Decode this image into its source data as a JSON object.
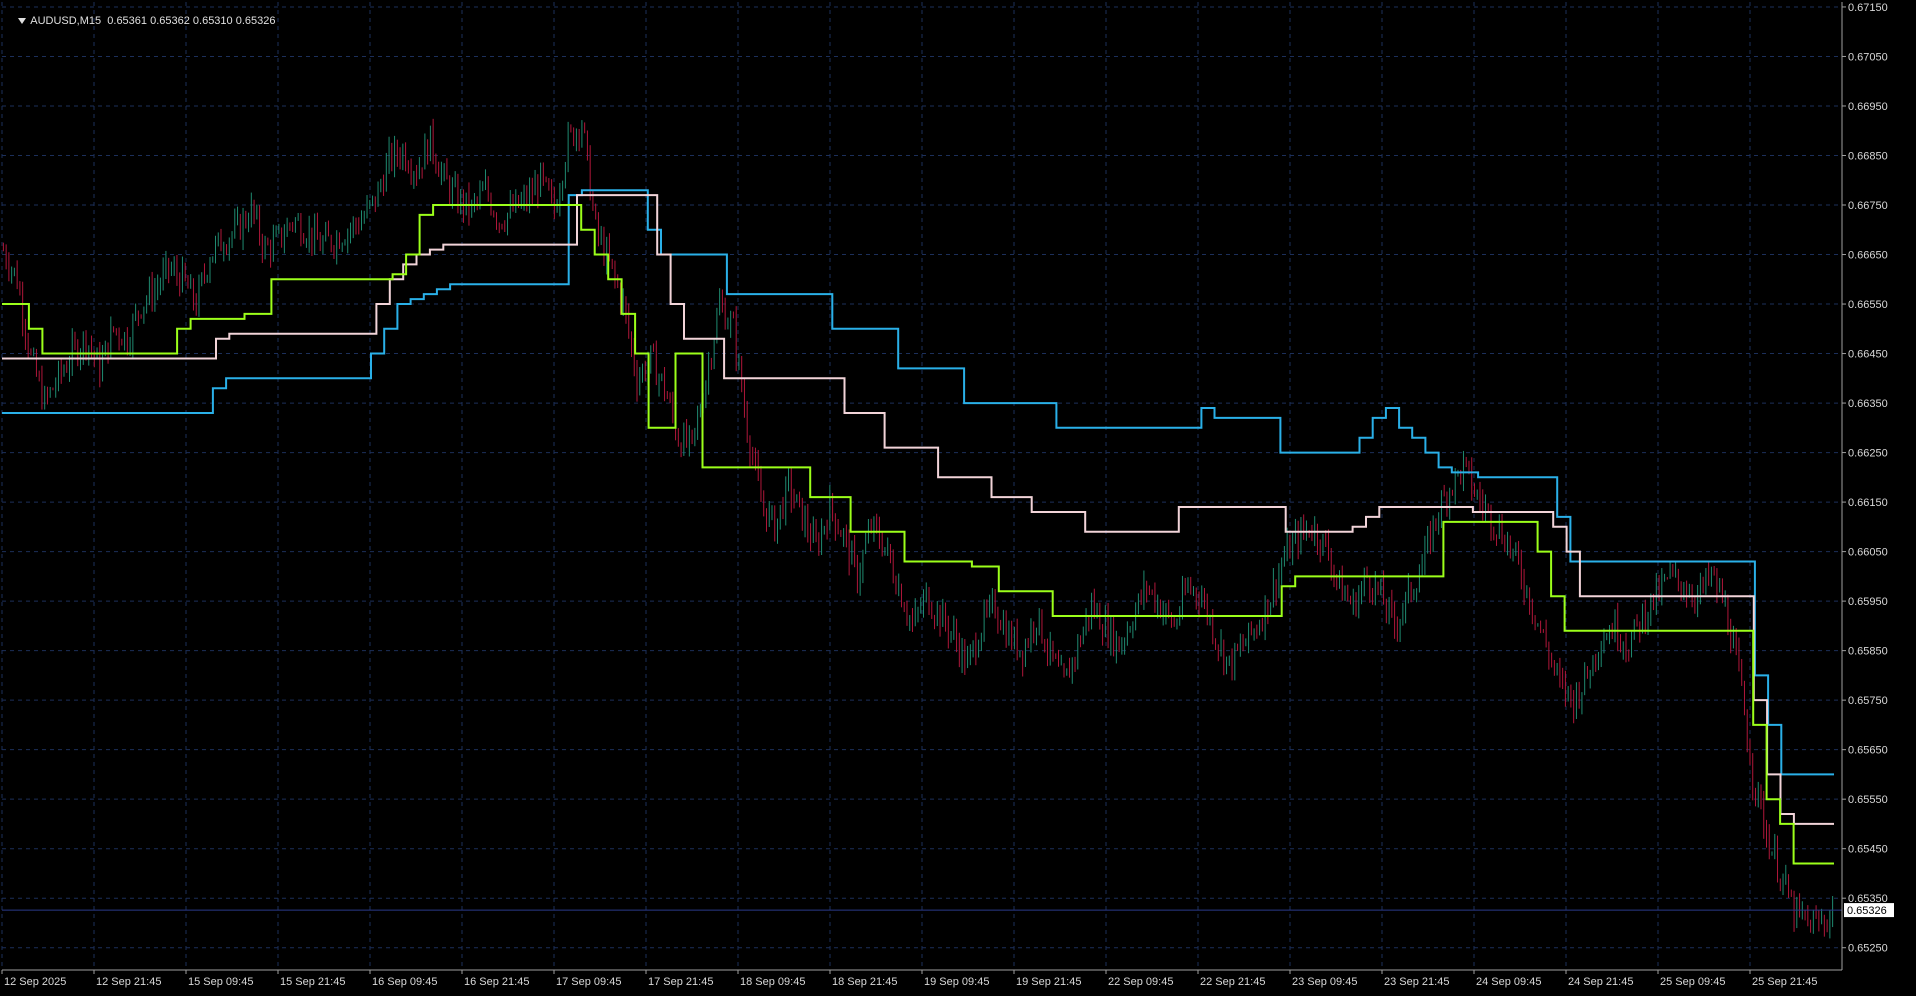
{
  "header": {
    "symbol": "AUDUSD,M15",
    "ohlc": "0.65361 0.65362 0.65310 0.65326"
  },
  "colors": {
    "background": "#000000",
    "grid": "#1c2f5a",
    "axis": "#a0a0a0",
    "candle_up": "#1f8a70",
    "candle_down": "#b0173a",
    "upper_band": "#2ab0e8",
    "middle_band": "#f2d4d9",
    "lower_band": "#9cff1a",
    "current_price_line": "#2a3a8a"
  },
  "chart_data": {
    "type": "line",
    "title": "",
    "symbol": "AUDUSD",
    "timeframe": "M15",
    "current_price": 0.65326,
    "current_price_label": "0.65326",
    "ylim": [
      0.65205,
      0.6716
    ],
    "grid": true,
    "y_ticks": [
      "0.67150",
      "0.67050",
      "0.66950",
      "0.66850",
      "0.66750",
      "0.66650",
      "0.66550",
      "0.66450",
      "0.66350",
      "0.66250",
      "0.66150",
      "0.66050",
      "0.65950",
      "0.65850",
      "0.65750",
      "0.65650",
      "0.65550",
      "0.65450",
      "0.65350",
      "0.65250"
    ],
    "x_ticks": [
      "12 Sep 2025",
      "12 Sep 21:45",
      "15 Sep 09:45",
      "15 Sep 21:45",
      "16 Sep 09:45",
      "16 Sep 21:45",
      "17 Sep 09:45",
      "17 Sep 21:45",
      "18 Sep 09:45",
      "18 Sep 21:45",
      "19 Sep 09:45",
      "19 Sep 21:45",
      "22 Sep 09:45",
      "22 Sep 21:45",
      "23 Sep 09:45",
      "23 Sep 21:45",
      "24 Sep 09:45",
      "24 Sep 21:45",
      "25 Sep 09:45",
      "25 Sep 21:45"
    ],
    "price_path": [
      0.6666,
      0.666,
      0.6644,
      0.6635,
      0.664,
      0.6645,
      0.6648,
      0.6642,
      0.665,
      0.6648,
      0.6655,
      0.6658,
      0.6662,
      0.666,
      0.6655,
      0.6665,
      0.6668,
      0.667,
      0.6674,
      0.6666,
      0.6668,
      0.6672,
      0.667,
      0.6667,
      0.6668,
      0.667,
      0.6672,
      0.6676,
      0.6684,
      0.6686,
      0.6682,
      0.6688,
      0.668,
      0.6676,
      0.6674,
      0.6678,
      0.6672,
      0.6674,
      0.6676,
      0.668,
      0.6674,
      0.6688,
      0.6692,
      0.667,
      0.6663,
      0.6655,
      0.664,
      0.6644,
      0.6638,
      0.6628,
      0.6626,
      0.664,
      0.6655,
      0.665,
      0.663,
      0.6615,
      0.661,
      0.6618,
      0.6612,
      0.6606,
      0.6614,
      0.6608,
      0.66,
      0.661,
      0.6606,
      0.6598,
      0.659,
      0.6596,
      0.6592,
      0.6588,
      0.6582,
      0.659,
      0.6594,
      0.6588,
      0.6585,
      0.6592,
      0.6584,
      0.6578,
      0.6586,
      0.6594,
      0.659,
      0.6586,
      0.6592,
      0.6598,
      0.6594,
      0.659,
      0.6598,
      0.6596,
      0.6588,
      0.6582,
      0.6586,
      0.659,
      0.6596,
      0.6604,
      0.6608,
      0.661,
      0.6606,
      0.6598,
      0.6594,
      0.66,
      0.6596,
      0.659,
      0.6596,
      0.6602,
      0.6612,
      0.6618,
      0.6622,
      0.6616,
      0.6612,
      0.6608,
      0.6602,
      0.6594,
      0.6586,
      0.6578,
      0.6575,
      0.658,
      0.6588,
      0.659,
      0.6586,
      0.6592,
      0.6596,
      0.66,
      0.6598,
      0.6596,
      0.66,
      0.6594,
      0.658,
      0.656,
      0.6548,
      0.654,
      0.6532,
      0.653,
      0.653,
      0.65326
    ],
    "series": [
      {
        "color": "#2ab0e8",
        "values": [
          0.6633,
          0.6633,
          0.6633,
          0.6633,
          0.6633,
          0.6633,
          0.6633,
          0.6633,
          0.6633,
          0.6633,
          0.6633,
          0.6633,
          0.6633,
          0.6633,
          0.6633,
          0.6633,
          0.6638,
          0.664,
          0.664,
          0.664,
          0.664,
          0.664,
          0.664,
          0.664,
          0.664,
          0.664,
          0.664,
          0.664,
          0.6645,
          0.665,
          0.6655,
          0.6656,
          0.6657,
          0.6658,
          0.6659,
          0.6659,
          0.6659,
          0.6659,
          0.6659,
          0.6659,
          0.6659,
          0.6659,
          0.6659,
          0.6677,
          0.6678,
          0.6678,
          0.6678,
          0.6678,
          0.6678,
          0.667,
          0.6665,
          0.6665,
          0.6665,
          0.6665,
          0.6665,
          0.6657,
          0.6657,
          0.6657,
          0.6657,
          0.6657,
          0.6657,
          0.6657,
          0.6657,
          0.665,
          0.665,
          0.665,
          0.665,
          0.665,
          0.6642,
          0.6642,
          0.6642,
          0.6642,
          0.6642,
          0.6635,
          0.6635,
          0.6635,
          0.6635,
          0.6635,
          0.6635,
          0.6635,
          0.663,
          0.663,
          0.663,
          0.663,
          0.663,
          0.663,
          0.663,
          0.663,
          0.663,
          0.663,
          0.663,
          0.6634,
          0.6632,
          0.6632,
          0.6632,
          0.6632,
          0.6632,
          0.6625,
          0.6625,
          0.6625,
          0.6625,
          0.6625,
          0.6625,
          0.6628,
          0.6632,
          0.6634,
          0.663,
          0.6628,
          0.6625,
          0.6622,
          0.6621,
          0.6621,
          0.662,
          0.662,
          0.662,
          0.662,
          0.662,
          0.662,
          0.6612,
          0.6603,
          0.6603,
          0.6603,
          0.6603,
          0.6603,
          0.6603,
          0.6603,
          0.6603,
          0.6603,
          0.6603,
          0.6603,
          0.6603,
          0.6603,
          0.6603,
          0.658,
          0.657,
          0.656,
          0.656,
          0.656,
          0.656
        ]
      },
      {
        "color": "#f2d4d9",
        "values": [
          0.6644,
          0.6644,
          0.6644,
          0.6644,
          0.6644,
          0.6644,
          0.6644,
          0.6644,
          0.6644,
          0.6644,
          0.6644,
          0.6644,
          0.6644,
          0.6644,
          0.6644,
          0.6644,
          0.6648,
          0.6649,
          0.6649,
          0.6649,
          0.6649,
          0.6649,
          0.6649,
          0.6649,
          0.6649,
          0.6649,
          0.6649,
          0.6649,
          0.6655,
          0.666,
          0.6663,
          0.6665,
          0.6666,
          0.6667,
          0.6667,
          0.6667,
          0.6667,
          0.6667,
          0.6667,
          0.6667,
          0.6667,
          0.6667,
          0.6667,
          0.6677,
          0.6677,
          0.6677,
          0.6677,
          0.6677,
          0.6677,
          0.6665,
          0.6655,
          0.6648,
          0.6648,
          0.6648,
          0.664,
          0.664,
          0.664,
          0.664,
          0.664,
          0.664,
          0.664,
          0.664,
          0.664,
          0.6633,
          0.6633,
          0.6633,
          0.6626,
          0.6626,
          0.6626,
          0.6626,
          0.662,
          0.662,
          0.662,
          0.662,
          0.6616,
          0.6616,
          0.6616,
          0.6613,
          0.6613,
          0.6613,
          0.6613,
          0.6609,
          0.6609,
          0.6609,
          0.6609,
          0.6609,
          0.6609,
          0.6609,
          0.6614,
          0.6614,
          0.6614,
          0.6614,
          0.6614,
          0.6614,
          0.6614,
          0.6614,
          0.6609,
          0.6609,
          0.6609,
          0.6609,
          0.6609,
          0.661,
          0.6612,
          0.6614,
          0.6614,
          0.6614,
          0.6614,
          0.6614,
          0.6614,
          0.6614,
          0.6613,
          0.6613,
          0.6613,
          0.6613,
          0.6613,
          0.6613,
          0.661,
          0.6605,
          0.6596,
          0.6596,
          0.6596,
          0.6596,
          0.6596,
          0.6596,
          0.6596,
          0.6596,
          0.6596,
          0.6596,
          0.6596,
          0.6596,
          0.6596,
          0.6575,
          0.656,
          0.6552,
          0.655,
          0.655,
          0.655
        ]
      },
      {
        "color": "#9cff1a",
        "values": [
          0.6655,
          0.6655,
          0.665,
          0.6645,
          0.6645,
          0.6645,
          0.6645,
          0.6645,
          0.6645,
          0.6645,
          0.6645,
          0.6645,
          0.6645,
          0.665,
          0.6652,
          0.6652,
          0.6652,
          0.6652,
          0.6653,
          0.6653,
          0.666,
          0.666,
          0.666,
          0.666,
          0.666,
          0.666,
          0.666,
          0.666,
          0.666,
          0.6661,
          0.6665,
          0.6673,
          0.6675,
          0.6675,
          0.6675,
          0.6675,
          0.6675,
          0.6675,
          0.6675,
          0.6675,
          0.6675,
          0.6675,
          0.6675,
          0.667,
          0.6665,
          0.666,
          0.6653,
          0.6645,
          0.663,
          0.663,
          0.6645,
          0.6645,
          0.6622,
          0.6622,
          0.6622,
          0.6622,
          0.6622,
          0.6622,
          0.6622,
          0.6622,
          0.6616,
          0.6616,
          0.6616,
          0.6609,
          0.6609,
          0.6609,
          0.6609,
          0.6603,
          0.6603,
          0.6603,
          0.6603,
          0.6603,
          0.6602,
          0.6602,
          0.6597,
          0.6597,
          0.6597,
          0.6597,
          0.6592,
          0.6592,
          0.6592,
          0.6592,
          0.6592,
          0.6592,
          0.6592,
          0.6592,
          0.6592,
          0.6592,
          0.6592,
          0.6592,
          0.6592,
          0.6592,
          0.6592,
          0.6592,
          0.6592,
          0.6598,
          0.66,
          0.66,
          0.66,
          0.66,
          0.66,
          0.66,
          0.66,
          0.66,
          0.66,
          0.66,
          0.66,
          0.6611,
          0.6611,
          0.6611,
          0.6611,
          0.6611,
          0.6611,
          0.6611,
          0.6605,
          0.6596,
          0.6589,
          0.6589,
          0.6589,
          0.6589,
          0.6589,
          0.6589,
          0.6589,
          0.6589,
          0.6589,
          0.6589,
          0.6589,
          0.6589,
          0.6589,
          0.6589,
          0.657,
          0.6555,
          0.655,
          0.6542,
          0.6542,
          0.6542
        ]
      }
    ]
  }
}
